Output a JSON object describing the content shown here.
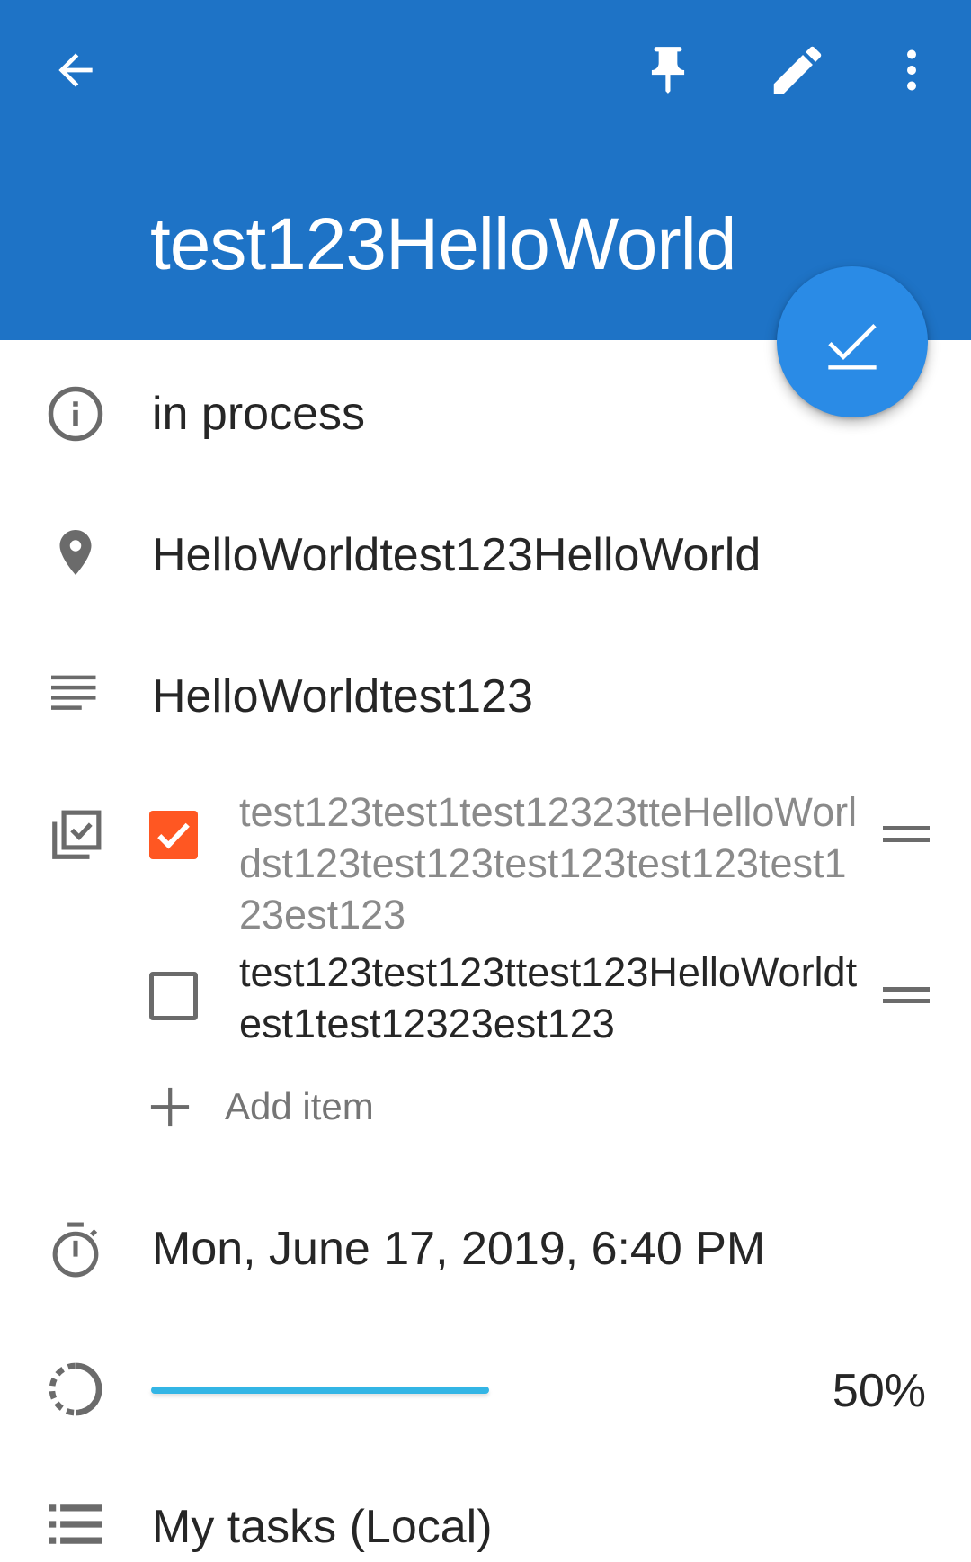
{
  "header": {
    "title": "test123HelloWorld",
    "background": "#1E73C6",
    "icons": {
      "back": "arrow-back-icon",
      "pin": "pin-icon",
      "edit": "pencil-icon",
      "more": "more-vert-icon"
    }
  },
  "fab": {
    "icon": "check-icon",
    "color": "#2A8BE6"
  },
  "details": {
    "status": "in process",
    "location": "HelloWorldtest123HelloWorld",
    "description": "HelloWorldtest123",
    "due": "Mon, June 17, 2019, 6:40 PM",
    "list": "My tasks (Local)"
  },
  "checklist": {
    "items": [
      {
        "text": "test123test1test12323tteHelloWorldst123test123test123test123test123est123",
        "checked": true
      },
      {
        "text": "test123test123ttest123HelloWorldtest1test12323est123",
        "checked": false
      }
    ],
    "add_label": "Add item",
    "checked_color": "#FF5722"
  },
  "progress": {
    "label": "50%",
    "value": 0.5,
    "color": "#33B5E5"
  }
}
